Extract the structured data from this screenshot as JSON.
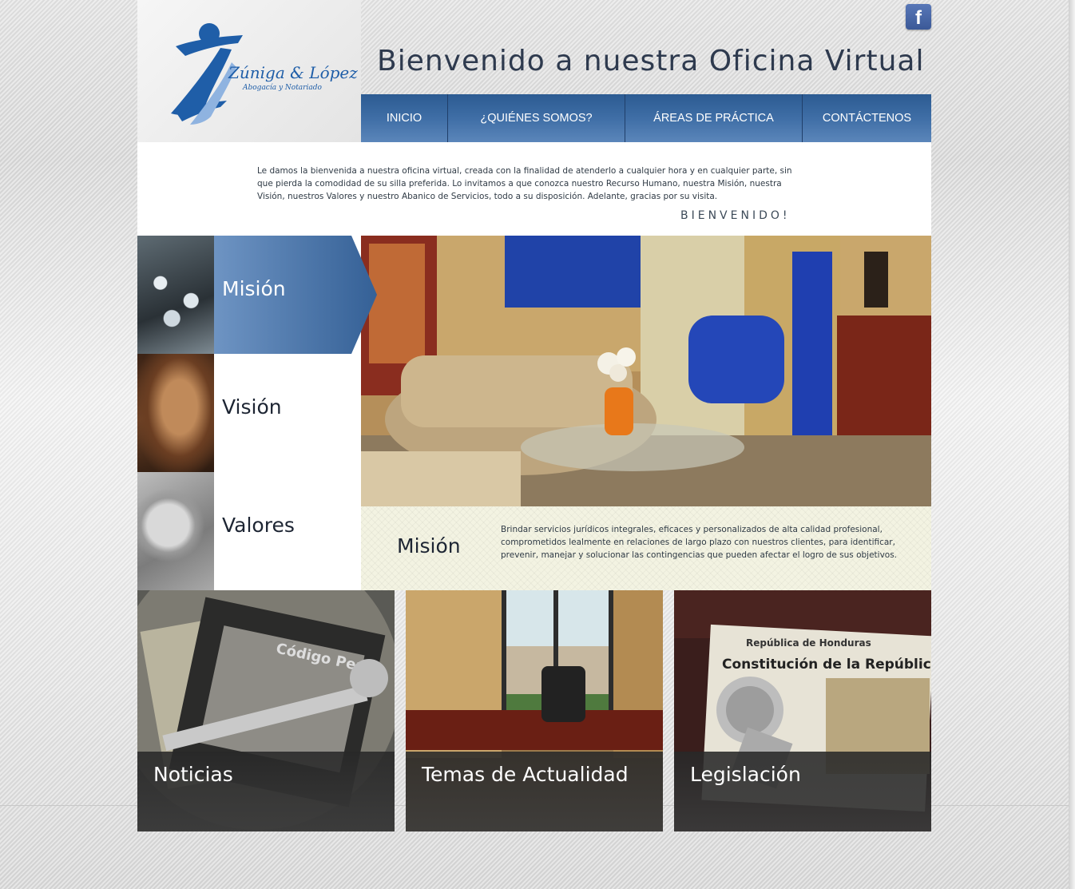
{
  "site": {
    "title": "Bienvenido a nuestra Oficina Virtual",
    "logo": {
      "name": "Zúniga & López",
      "tagline": "Abogacía y Notariado"
    },
    "facebook_icon": "facebook-icon",
    "facebook_glyph": "f"
  },
  "nav": {
    "items": [
      {
        "label": "INICIO"
      },
      {
        "label": "¿QUIÉNES SOMOS?"
      },
      {
        "label": "ÁREAS DE PRÁCTICA"
      },
      {
        "label": "CONTÁCTENOS"
      }
    ]
  },
  "welcome": {
    "text": "Le damos la bienvenida a nuestra oficina virtual, creada con la finalidad de atenderlo a cualquier hora y en cualquier parte, sin que pierda la comodidad de su silla preferida. Lo invitamos a que conozca nuestro Recurso Humano, nuestra Misión, nuestra Visión, nuestros Valores y nuestro Abanico de Servicios, todo a su disposición. Adelante, gracias por su visita.",
    "greeting": "BIENVENIDO!"
  },
  "side": {
    "items": [
      {
        "label": "Misión",
        "active": true
      },
      {
        "label": "Visión",
        "active": false
      },
      {
        "label": "Valores",
        "active": false
      }
    ]
  },
  "info": {
    "title": "Misión",
    "text": "Brindar servicios jurídicos integrales, eficaces y personalizados de alta calidad profesional, comprometidos lealmente en relaciones de largo plazo con nuestros clientes, para identificar, prevenir, manejar y solucionar las contingencias que pueden afectar el logro de sus objetivos."
  },
  "tiles": [
    {
      "label": "Noticias"
    },
    {
      "label": "Temas de Actualidad"
    },
    {
      "label": "Legislación"
    }
  ],
  "colors": {
    "nav_blue": "#3f6ea6",
    "logo_dark_blue": "#1f5ea8",
    "logo_light_blue": "#8fb3e0",
    "panel_cream": "#f3f3e2"
  }
}
